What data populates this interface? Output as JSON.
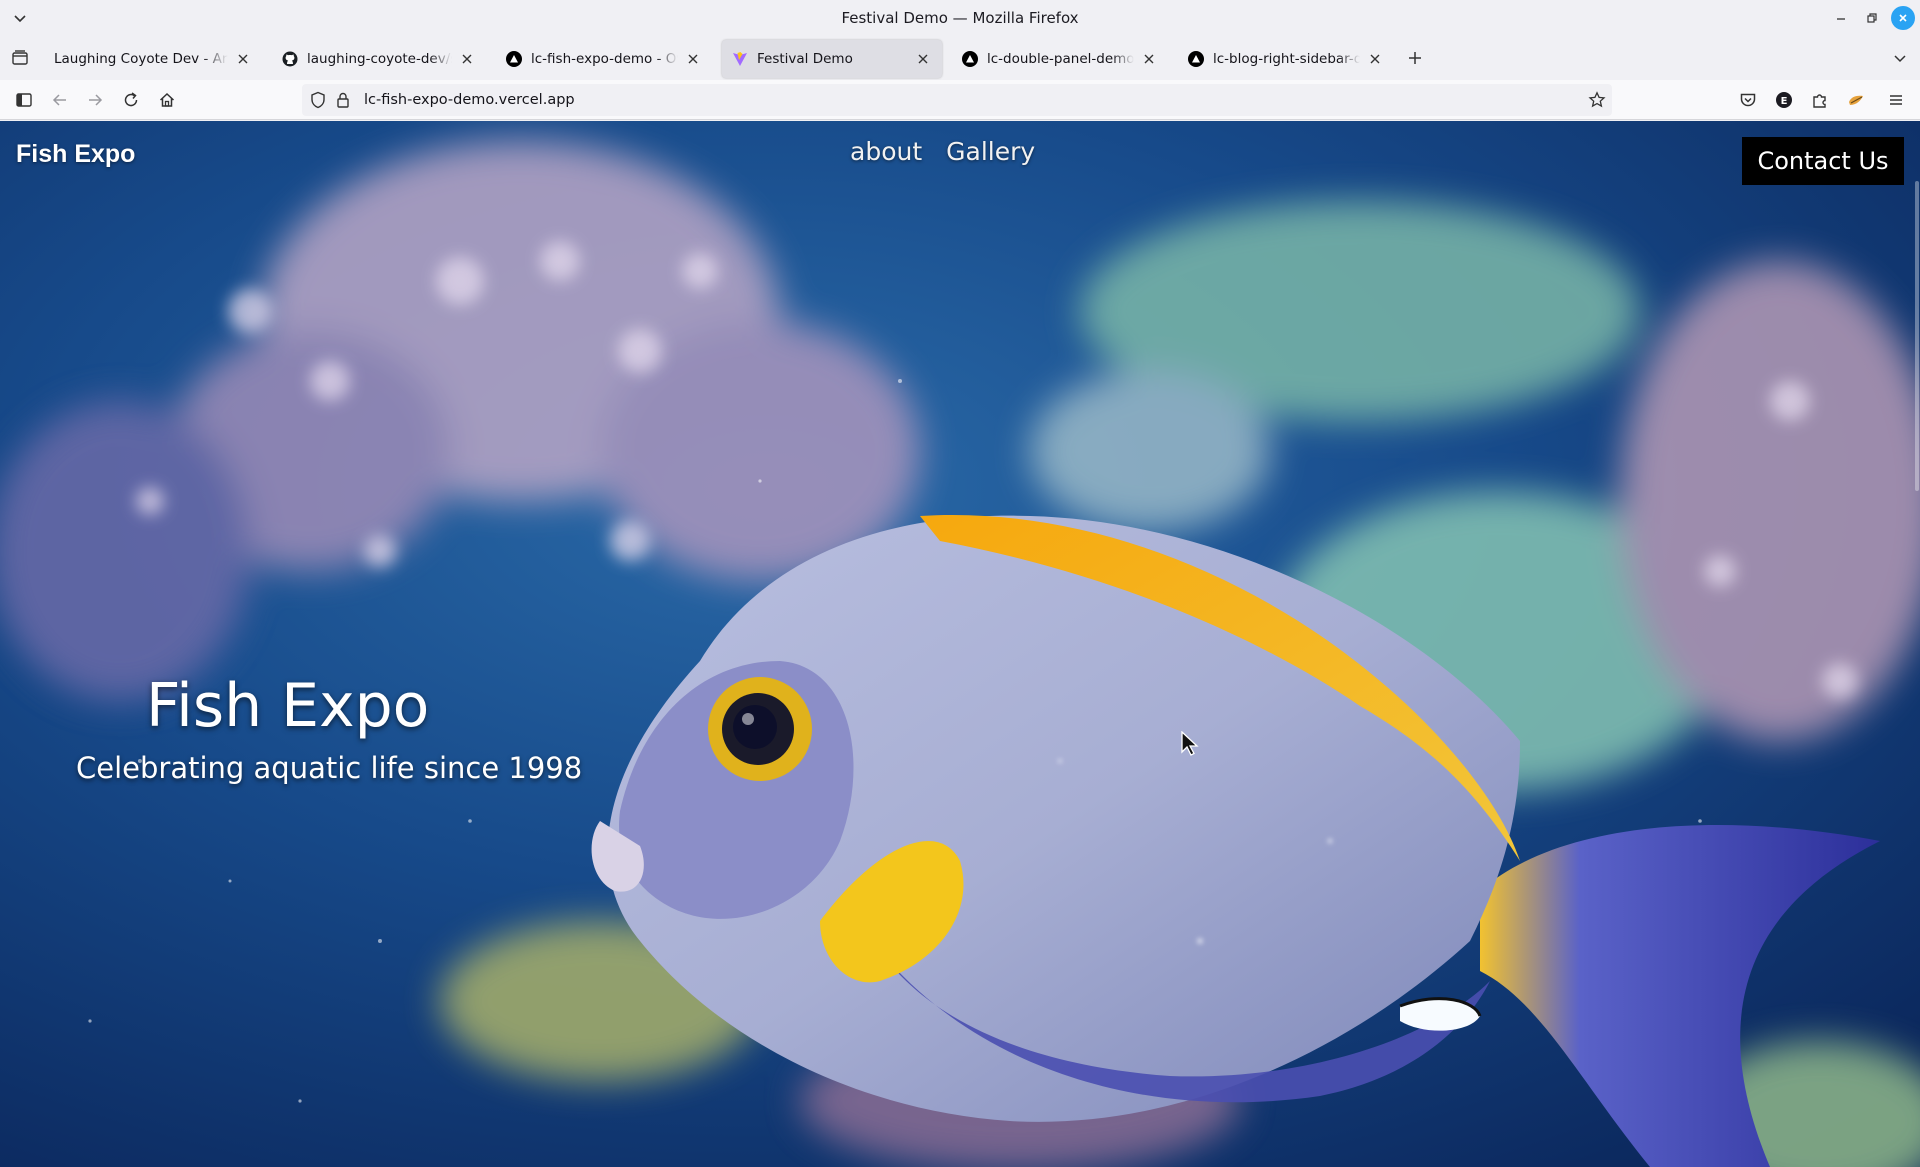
{
  "window": {
    "title": "Festival Demo — Mozilla Firefox"
  },
  "tabs": [
    {
      "label": "Laughing Coyote Dev - Articles, T",
      "favicon": "none",
      "active": false
    },
    {
      "label": "laughing-coyote-dev/src/conte",
      "favicon": "github-icon",
      "active": false
    },
    {
      "label": "lc-fish-expo-demo - Overview",
      "favicon": "vercel-icon",
      "active": false
    },
    {
      "label": "Festival Demo",
      "favicon": "vite-icon",
      "active": true
    },
    {
      "label": "lc-double-panel-demo - Overvi",
      "favicon": "vercel-icon",
      "active": false
    },
    {
      "label": "lc-blog-right-sidebar-demo-l",
      "favicon": "vercel-icon",
      "active": false
    }
  ],
  "navbar": {
    "url": "lc-fish-expo-demo.vercel.app"
  },
  "site": {
    "logo": "Fish Expo",
    "nav": [
      "about",
      "Gallery"
    ],
    "contact_button": "Contact Us",
    "hero_title": "Fish Expo",
    "hero_subtitle": "Celebrating aquatic life since 1998"
  },
  "colors": {
    "accent": "#2aa3f3",
    "contact_bg": "#000000",
    "ocean_deep": "#0d2a5c",
    "fish_body": "#a8b3d6",
    "fish_yellow": "#f2b400"
  }
}
